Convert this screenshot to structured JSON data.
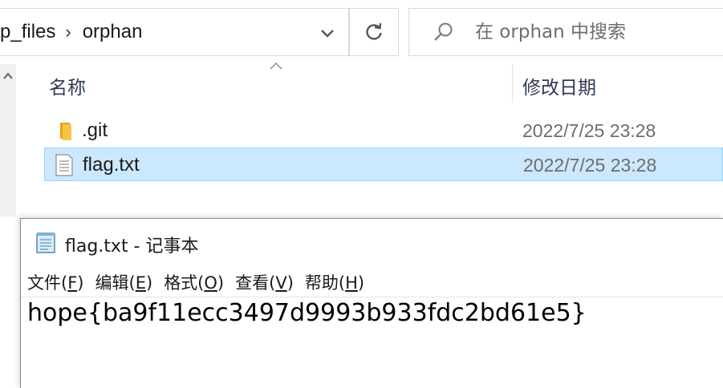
{
  "explorer": {
    "breadcrumb": {
      "parent": "p_files",
      "current": "orphan"
    },
    "search": {
      "placeholder": "在 orphan 中搜索"
    },
    "columns": {
      "name": "名称",
      "date_modified": "修改日期"
    },
    "files": [
      {
        "name": ".git",
        "date": "2022/7/25 23:28",
        "icon": "folder-icon",
        "selected": false
      },
      {
        "name": "flag.txt",
        "date": "2022/7/25 23:28",
        "icon": "text-file-icon",
        "selected": true
      }
    ],
    "colors": {
      "selection_bg": "#cce8ff",
      "selection_border": "#99d1ff",
      "folder": "#f2c14e"
    }
  },
  "notepad": {
    "title": "flag.txt - 记事本",
    "menu": [
      {
        "label": "文件(",
        "accel": "F",
        "close": ")"
      },
      {
        "label": "编辑(",
        "accel": "E",
        "close": ")"
      },
      {
        "label": "格式(",
        "accel": "O",
        "close": ")"
      },
      {
        "label": "查看(",
        "accel": "V",
        "close": ")"
      },
      {
        "label": "帮助(",
        "accel": "H",
        "close": ")"
      }
    ],
    "content": "hope{ba9f11ecc3497d9993b933fdc2bd61e5}"
  }
}
